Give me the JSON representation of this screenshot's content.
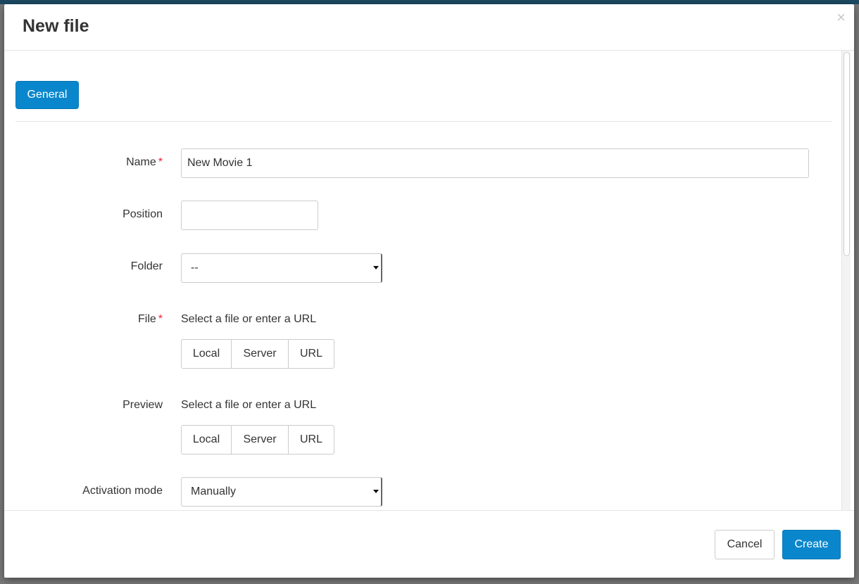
{
  "colors": {
    "accent": "#0a87cc",
    "required": "#ee2233",
    "backdrop": "#7a7a7a"
  },
  "modal": {
    "title": "New file",
    "close_icon": "close-icon",
    "close_glyph": "×"
  },
  "tabs": [
    {
      "label": "General",
      "active": true
    }
  ],
  "form": {
    "required_marker": "*",
    "name": {
      "label": "Name",
      "value": "New Movie 1",
      "required": true
    },
    "position": {
      "label": "Position",
      "value": ""
    },
    "folder": {
      "label": "Folder",
      "selected": "--"
    },
    "file": {
      "label": "File",
      "required": true,
      "help": "Select a file or enter a URL",
      "options": [
        "Local",
        "Server",
        "URL"
      ]
    },
    "preview": {
      "label": "Preview",
      "help": "Select a file or enter a URL",
      "options": [
        "Local",
        "Server",
        "URL"
      ]
    },
    "activation_mode": {
      "label": "Activation mode",
      "selected": "Manually"
    }
  },
  "footer": {
    "cancel_label": "Cancel",
    "create_label": "Create"
  }
}
